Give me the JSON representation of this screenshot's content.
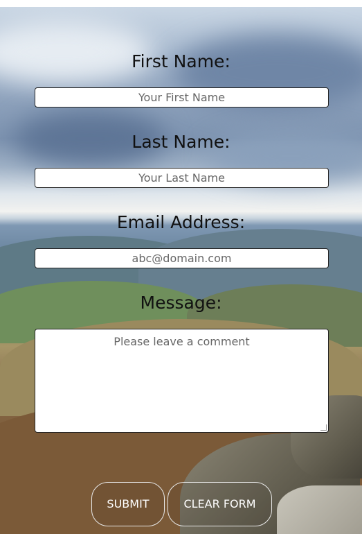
{
  "form": {
    "first_name_label": "First Name:",
    "first_name_placeholder": "Your First Name",
    "last_name_label": "Last Name:",
    "last_name_placeholder": "Your Last Name",
    "email_label": "Email Address:",
    "email_placeholder": "abc@domain.com",
    "message_label": "Message:",
    "message_placeholder": "Please leave a comment",
    "submit_label": "SUBMIT",
    "clear_label": "CLEAR FORM"
  },
  "colors": {
    "label_text": "#111111",
    "field_border": "#222222",
    "button_border": "#e8e8e8",
    "button_text": "#ffffff"
  }
}
